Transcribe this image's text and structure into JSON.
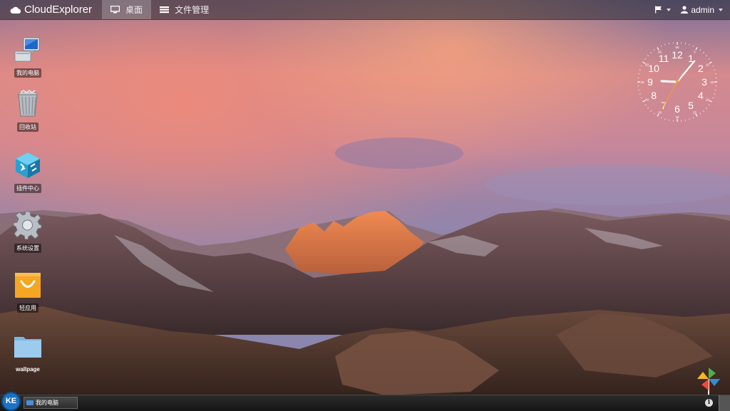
{
  "app": {
    "title": "CloudExplorer"
  },
  "topbar": {
    "tabs": [
      {
        "label": "桌面",
        "icon": "monitor-icon",
        "active": true
      },
      {
        "label": "文件管理",
        "icon": "list-icon",
        "active": false
      }
    ],
    "user": "admin"
  },
  "desktop": {
    "icons": [
      {
        "label": "我的电脑",
        "icon": "computer-icon"
      },
      {
        "label": "回收站",
        "icon": "trash-icon"
      },
      {
        "label": "插件中心",
        "icon": "plugin-cube-icon"
      },
      {
        "label": "系统设置",
        "icon": "gear-icon"
      },
      {
        "label": "轻应用",
        "icon": "shopping-bag-icon"
      },
      {
        "label": "wallpage",
        "icon": "folder-icon"
      }
    ]
  },
  "clock": {
    "numbers": [
      "12",
      "1",
      "2",
      "3",
      "4",
      "5",
      "6",
      "7",
      "8",
      "9",
      "10",
      "11"
    ],
    "minute_marks": [
      "60",
      "5",
      "10",
      "15",
      "20",
      "25",
      "30",
      "35",
      "40",
      "45",
      "50",
      "55"
    ],
    "time": {
      "hour": 9,
      "minute": 6,
      "second": 35
    }
  },
  "taskbar": {
    "start_label": "KE",
    "items": [
      {
        "label": "我的电脑"
      }
    ],
    "info_label": "i"
  },
  "colors": {
    "accent": "#1a72c4",
    "topbar": "#2b2b33",
    "folder": "#8ec3e8",
    "bag": "#f5a623"
  }
}
